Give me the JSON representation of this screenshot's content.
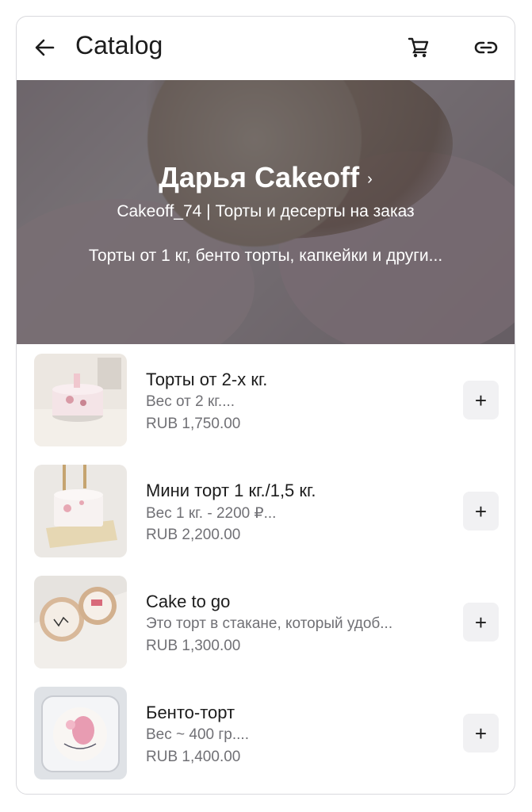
{
  "header": {
    "title": "Catalog",
    "back_icon": "arrow-left-icon",
    "cart_icon": "shopping-cart-icon",
    "link_icon": "link-icon"
  },
  "hero": {
    "name": "Дарья Cakeoff",
    "chevron": "›",
    "subtitle": "Cakeoff_74 | Торты и десерты на заказ",
    "description": "Торты от 1 кг, бенто торты, капкейки и други..."
  },
  "products": [
    {
      "name": "Торты от 2-х кг.",
      "description": "Вес от 2 кг....",
      "price": "RUB 1,750.00",
      "add_label": "+"
    },
    {
      "name": "Мини торт 1 кг./1,5 кг.",
      "description": "Вес 1 кг. - 2200 ₽...",
      "price": "RUB 2,200.00",
      "add_label": "+"
    },
    {
      "name": "Cake to go",
      "description": "Это торт в стакане, который удоб...",
      "price": "RUB 1,300.00",
      "add_label": "+"
    },
    {
      "name": "Бенто-торт",
      "description": "Вес ~ 400 гр....",
      "price": "RUB 1,400.00",
      "add_label": "+"
    }
  ]
}
